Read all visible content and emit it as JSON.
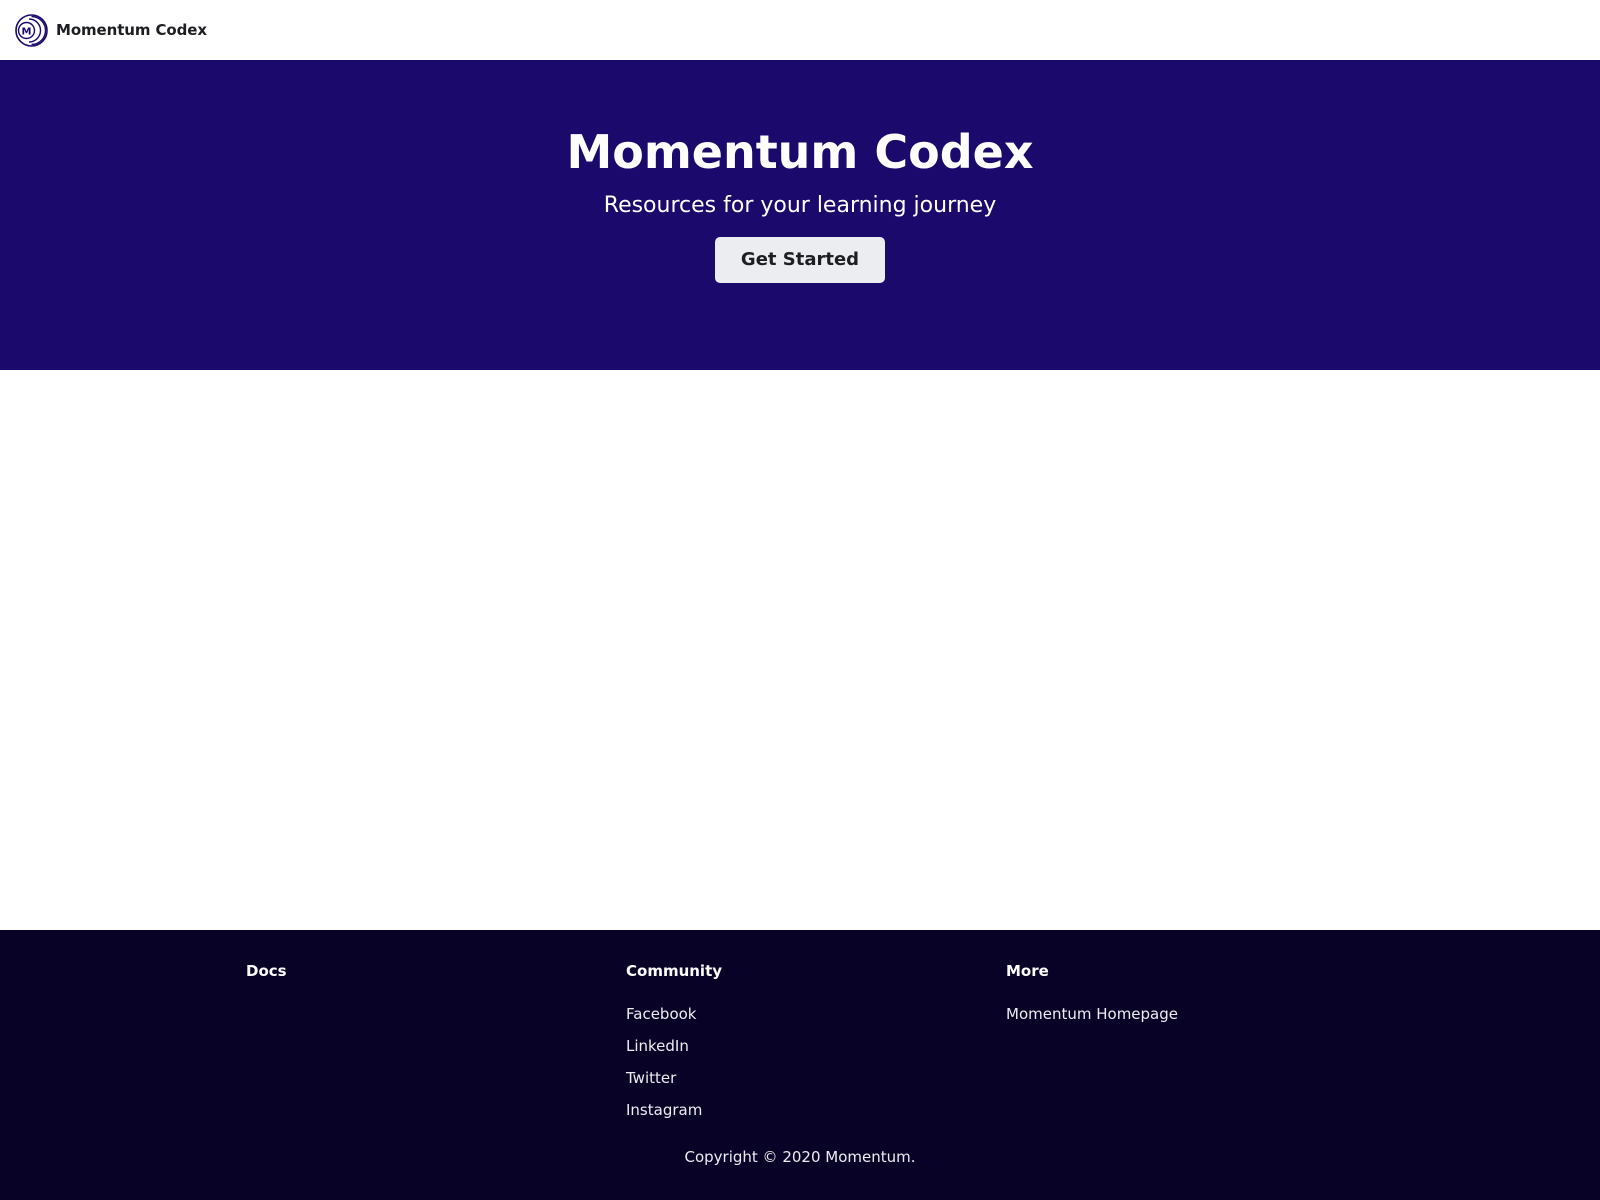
{
  "navbar": {
    "logo_icon": "momentum-logo-icon",
    "logo_letter": "M",
    "title": "Momentum Codex"
  },
  "hero": {
    "title": "Momentum Codex",
    "subtitle": "Resources for your learning journey",
    "cta_label": "Get Started"
  },
  "footer": {
    "columns": [
      {
        "title": "Docs",
        "links": []
      },
      {
        "title": "Community",
        "links": [
          "Facebook",
          "LinkedIn",
          "Twitter",
          "Instagram"
        ]
      },
      {
        "title": "More",
        "links": [
          "Momentum Homepage"
        ]
      }
    ],
    "copyright": "Copyright © 2020 Momentum."
  },
  "colors": {
    "hero_bg": "#1b0a6b",
    "footer_bg": "#080326",
    "button_bg": "#ebedf0",
    "logo_stroke": "#1b0a6b"
  }
}
